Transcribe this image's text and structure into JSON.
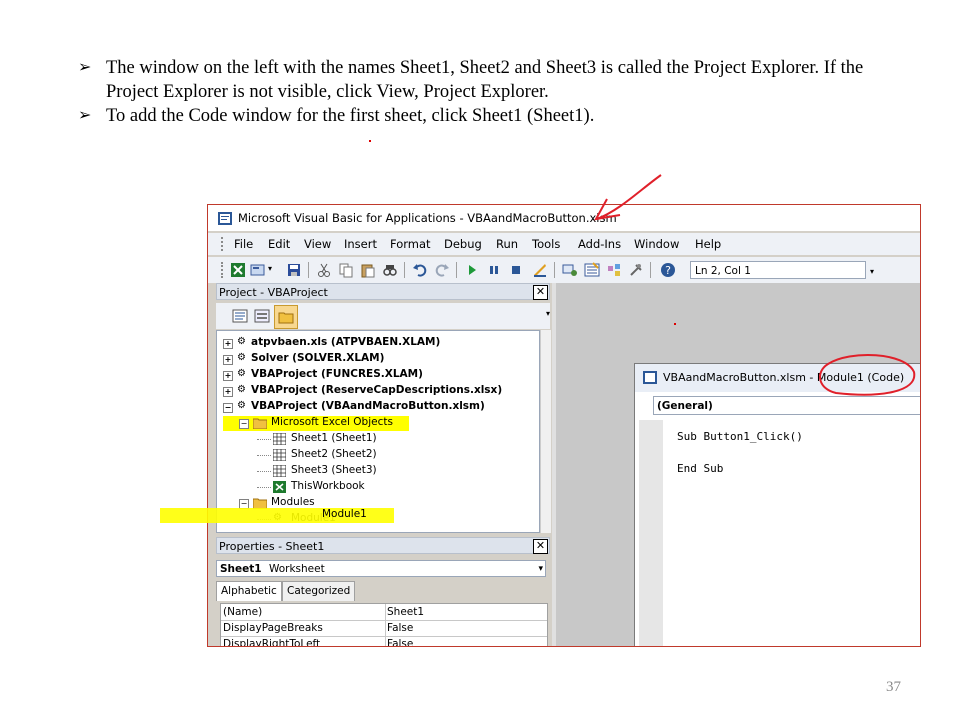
{
  "slide": {
    "bullets": [
      "The window on the left with the names Sheet1, Sheet2 and Sheet3 is called the Project Explorer. If the Project Explorer is not visible, click View, Project Explorer.",
      "To add the Code window for the first sheet, click Sheet1 (Sheet1)."
    ],
    "page_number": "37"
  },
  "vbe": {
    "title": "Microsoft Visual Basic for Applications - VBAandMacroButton.xlsm",
    "menu": [
      "File",
      "Edit",
      "View",
      "Insert",
      "Format",
      "Debug",
      "Run",
      "Tools",
      "Add-Ins",
      "Window",
      "Help"
    ],
    "position": "Ln 2, Col 1",
    "project_panel": {
      "title": "Project - VBAProject",
      "tree": [
        {
          "label": "atpvbaen.xls (ATPVBAEN.XLAM)",
          "bold": true
        },
        {
          "label": "Solver (SOLVER.XLAM)",
          "bold": true
        },
        {
          "label": "VBAProject (FUNCRES.XLAM)",
          "bold": true
        },
        {
          "label": "VBAProject (ReserveCapDescriptions.xlsx)",
          "bold": true
        },
        {
          "label": "VBAProject (VBAandMacroButton.xlsm)",
          "bold": true
        },
        {
          "label": "Microsoft Excel Objects",
          "bold": false
        },
        {
          "label": "Sheet1 (Sheet1)",
          "bold": false
        },
        {
          "label": "Sheet2 (Sheet2)",
          "bold": false
        },
        {
          "label": "Sheet3 (Sheet3)",
          "bold": false
        },
        {
          "label": "ThisWorkbook",
          "bold": false
        },
        {
          "label": "Modules",
          "bold": false
        },
        {
          "label": "Module1",
          "bold": false
        }
      ]
    },
    "properties_panel": {
      "title": "Properties - Sheet1",
      "object_name": "Sheet1",
      "object_type": "Worksheet",
      "tabs": [
        "Alphabetic",
        "Categorized"
      ],
      "rows": [
        {
          "name": "(Name)",
          "value": "Sheet1"
        },
        {
          "name": "DisplayPageBreaks",
          "value": "False"
        },
        {
          "name": "DisplayRightToLeft",
          "value": "False"
        }
      ]
    },
    "code_window": {
      "title": "VBAandMacroButton.xlsm - Module1 (Code)",
      "object_combo": "(General)",
      "lines": [
        "Sub Button1_Click()",
        "",
        "End Sub"
      ]
    }
  },
  "colors": {
    "highlight": "#ffff00",
    "annotation": "#e0202a"
  }
}
